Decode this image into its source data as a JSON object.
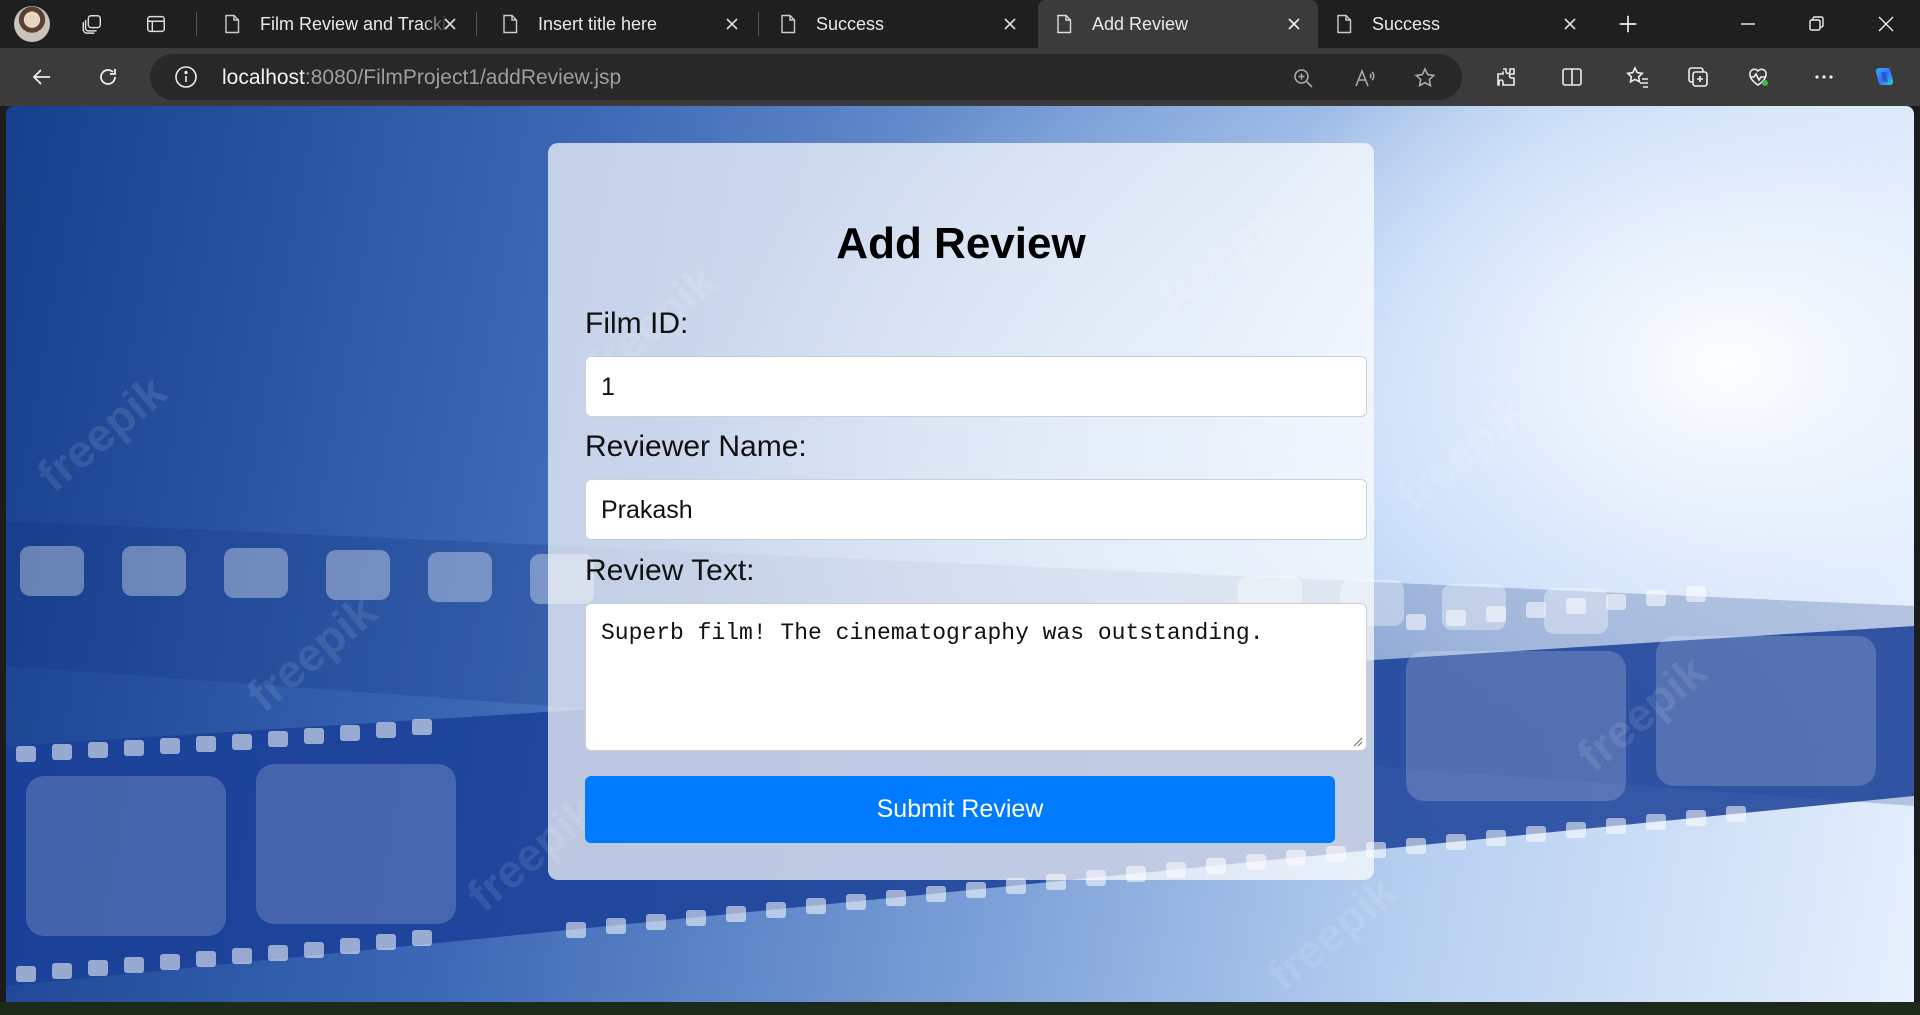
{
  "browser": {
    "tabs": [
      {
        "title": "Film Review and Tracking",
        "active": false
      },
      {
        "title": "Insert title here",
        "active": false
      },
      {
        "title": "Success",
        "active": false
      },
      {
        "title": "Add Review",
        "active": true
      },
      {
        "title": "Success",
        "active": false
      }
    ],
    "url_host": "localhost",
    "url_path": ":8080/FilmProject1/addReview.jsp"
  },
  "page": {
    "heading": "Add Review",
    "film_id_label": "Film ID:",
    "film_id_value": "1",
    "reviewer_label": "Reviewer Name:",
    "reviewer_value": "Prakash",
    "review_text_label": "Review Text:",
    "review_text_value": "Superb film! The cinematography was outstanding.",
    "submit_label": "Submit Review",
    "watermark_text": "freepik"
  },
  "colors": {
    "submit_button": "#007bff",
    "active_tab": "#3b3b3b",
    "tabstrip": "#1f1f1f"
  }
}
